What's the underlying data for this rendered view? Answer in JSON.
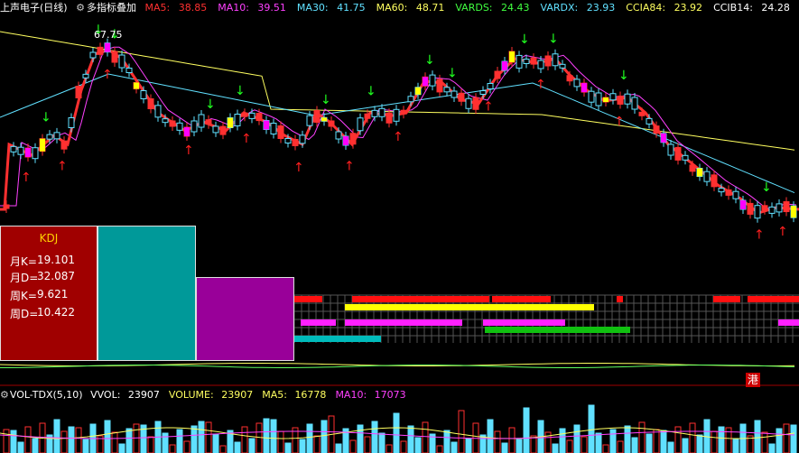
{
  "header": {
    "stock": "上声电子",
    "period": "(日线)",
    "indicator": "多指标叠加",
    "items": [
      {
        "label": "MA5:",
        "value": "38.85",
        "color": "#ff3030"
      },
      {
        "label": "MA10:",
        "value": "39.51",
        "color": "#ff40ff"
      },
      {
        "label": "MA30:",
        "value": "41.75",
        "color": "#60e0ff"
      },
      {
        "label": "MA60:",
        "value": "48.71",
        "color": "#ffff60"
      },
      {
        "label": "VARDS:",
        "value": "24.43",
        "color": "#40ff40"
      },
      {
        "label": "VARDX:",
        "value": "23.93",
        "color": "#60e0ff"
      },
      {
        "label": "CCIA84:",
        "value": "23.92",
        "color": "#ffff60"
      },
      {
        "label": "CCIB14:",
        "value": "24.28",
        "color": "#ffffff"
      }
    ]
  },
  "price_high_label": "67.75",
  "kdj": {
    "title": "KDJ",
    "rows": [
      {
        "label": "月K=",
        "value": "19.101"
      },
      {
        "label": "月D=",
        "value": "32.087"
      },
      {
        "label": "周K=",
        "value": "9.621"
      },
      {
        "label": "周D=",
        "value": "10.422"
      }
    ]
  },
  "volume": {
    "title": "VOL-TDX(5,10)",
    "items": [
      {
        "label": "VVOL:",
        "value": "23907",
        "color": "#ffffff"
      },
      {
        "label": "VOLUME:",
        "value": "23907",
        "color": "#ffff60"
      },
      {
        "label": "MA5:",
        "value": "16778",
        "color": "#ffff60"
      },
      {
        "label": "MA10:",
        "value": "17073",
        "color": "#ff40ff"
      }
    ]
  },
  "hk_badge": "港",
  "colors": {
    "up": "#ff3030",
    "down": "#60e0ff",
    "ma10": "#ff40ff",
    "ma30": "#60e0ff",
    "ma60": "#ffff60"
  }
}
